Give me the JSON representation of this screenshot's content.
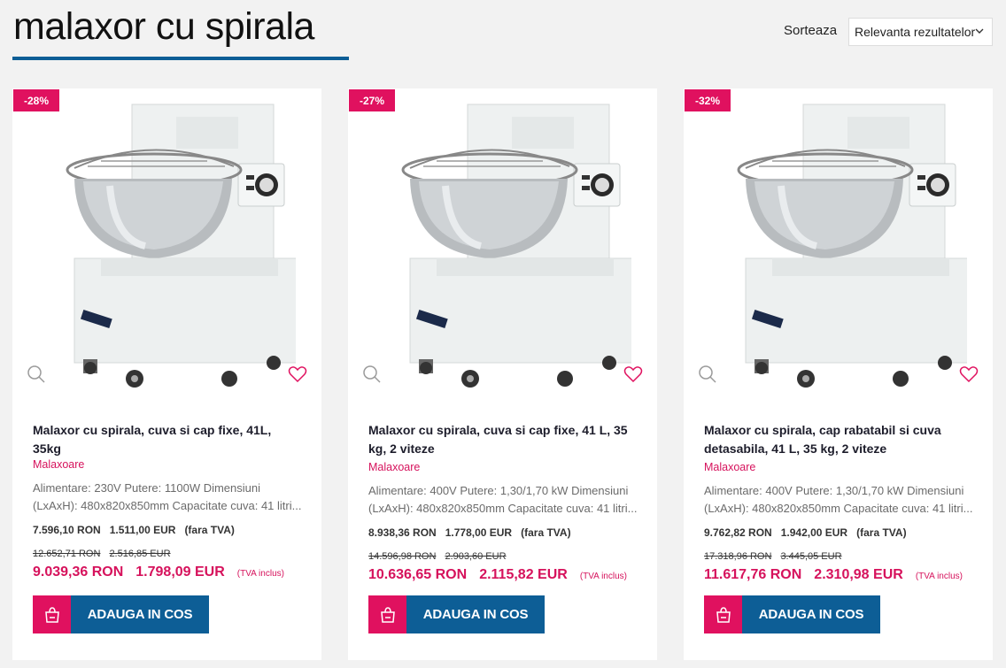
{
  "header": {
    "title": "malaxor cu spirala",
    "sort_label": "Sorteaza",
    "sort_value": "Relevanta rezultatelor"
  },
  "colors": {
    "accent": "#e0115f",
    "primary": "#0d5e96"
  },
  "products": [
    {
      "discount": "-28%",
      "name": "Malaxor cu spirala, cuva si cap fixe, 41L, 35kg",
      "category": "Malaxoare",
      "description": "Alimentare: 230V Putere: 1100W Dimensiuni (LxAxH): 480x820x850mm Capacitate cuva: 41 litri...",
      "price_ron_net": "7.596,10 RON",
      "price_eur_net": "1.511,00 EUR",
      "net_note": "(fara TVA)",
      "old_price_ron": "12.652,71 RON",
      "old_price_eur": "2.516,85 EUR",
      "price_ron_gross": "9.039,36 RON",
      "price_eur_gross": "1.798,09 EUR",
      "gross_note": "(TVA inclus)",
      "button_label": "ADAUGA IN COS"
    },
    {
      "discount": "-27%",
      "name": "Malaxor cu spirala, cuva si cap fixe, 41 L, 35 kg, 2 viteze",
      "category": "Malaxoare",
      "description": "Alimentare: 400V Putere: 1,30/1,70 kW Dimensiuni (LxAxH): 480x820x850mm Capacitate cuva: 41 litri...",
      "price_ron_net": "8.938,36 RON",
      "price_eur_net": "1.778,00 EUR",
      "net_note": "(fara TVA)",
      "old_price_ron": "14.596,98 RON",
      "old_price_eur": "2.903,60 EUR",
      "price_ron_gross": "10.636,65 RON",
      "price_eur_gross": "2.115,82 EUR",
      "gross_note": "(TVA inclus)",
      "button_label": "ADAUGA IN COS"
    },
    {
      "discount": "-32%",
      "name": "Malaxor cu spirala, cap rabatabil si cuva detasabila, 41 L, 35 kg, 2 viteze",
      "category": "Malaxoare",
      "description": "Alimentare: 400V Putere: 1,30/1,70 kW Dimensiuni (LxAxH): 480x820x850mm Capacitate cuva: 41 litri...",
      "price_ron_net": "9.762,82 RON",
      "price_eur_net": "1.942,00 EUR",
      "net_note": "(fara TVA)",
      "old_price_ron": "17.318,96 RON",
      "old_price_eur": "3.445,05 EUR",
      "price_ron_gross": "11.617,76 RON",
      "price_eur_gross": "2.310,98 EUR",
      "gross_note": "(TVA inclus)",
      "button_label": "ADAUGA IN COS"
    }
  ]
}
